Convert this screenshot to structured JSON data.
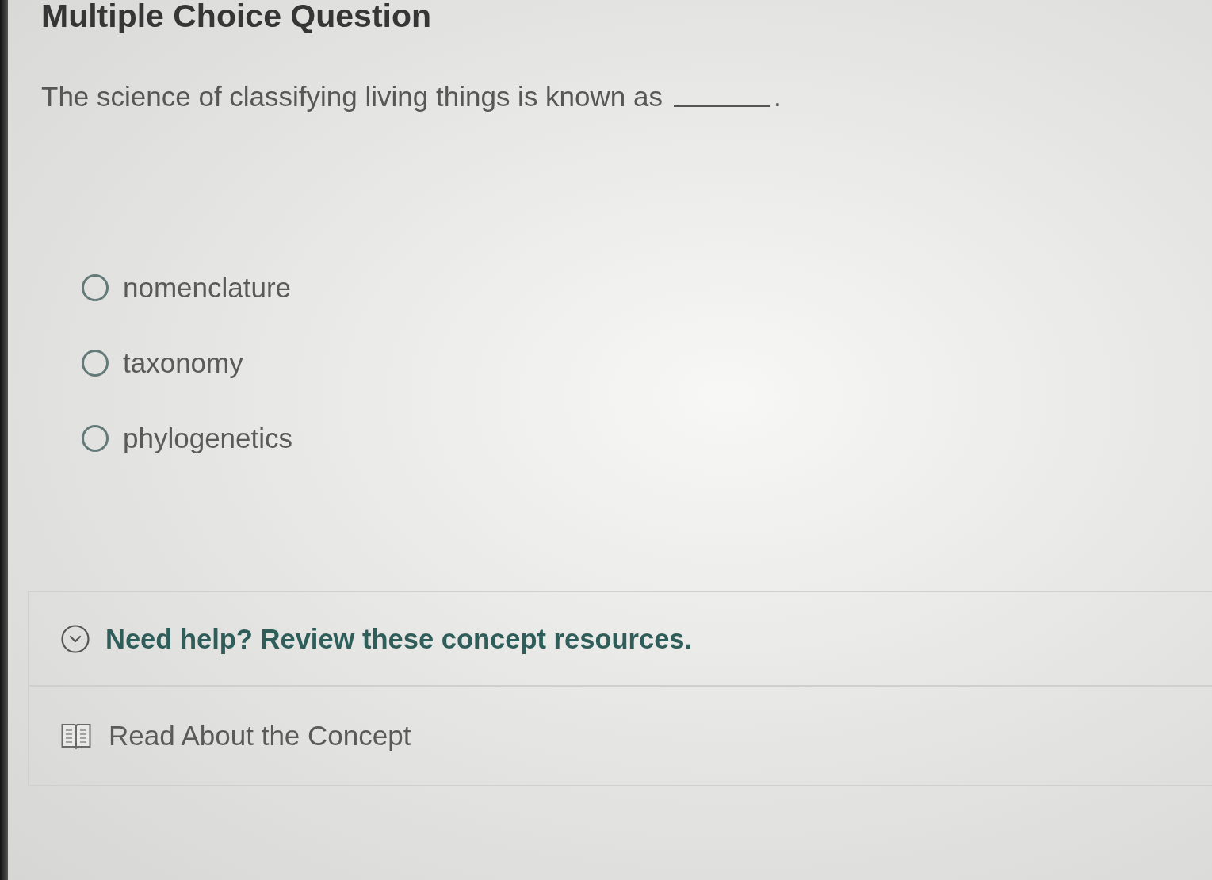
{
  "title": "Multiple Choice Question",
  "question": {
    "text": "The science of classifying living things is known as",
    "blank": true,
    "ending": "."
  },
  "options": [
    {
      "label": "nomenclature",
      "selected": false
    },
    {
      "label": "taxonomy",
      "selected": false
    },
    {
      "label": "phylogenetics",
      "selected": false
    }
  ],
  "help": {
    "title": "Need help? Review these concept resources.",
    "expanded": true,
    "resources": [
      {
        "label": "Read About the Concept"
      }
    ]
  }
}
